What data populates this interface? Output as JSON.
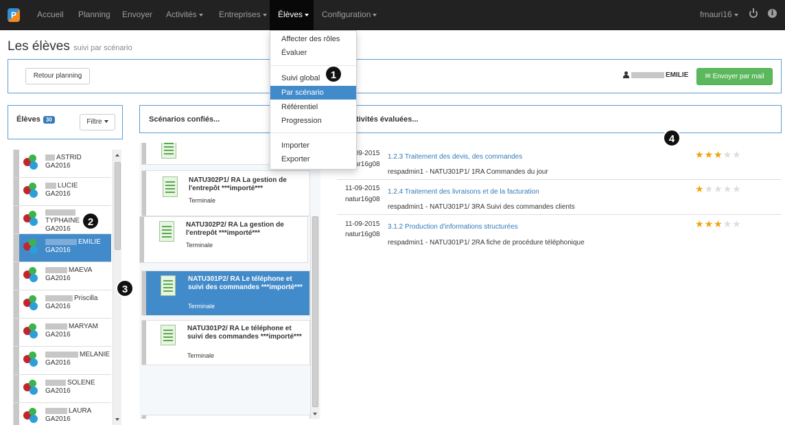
{
  "nav": {
    "items": [
      "Accueil",
      "Planning",
      "Envoyer",
      "Activités",
      "Entreprises",
      "Élèves",
      "Configuration"
    ],
    "user": "fmauri16",
    "logo": "P"
  },
  "dropdown": [
    "Affecter des rôles",
    "Évaluer",
    "Suivi global",
    "Par scénario",
    "Référentiel",
    "Progression",
    "Importer",
    "Exporter"
  ],
  "page": {
    "title": "Les élèves",
    "subtitle": "suivi par scénario"
  },
  "toolbar": {
    "back_label": "Retour planning",
    "student_first": "EMILIE",
    "mail_label": "Envoyer par mail",
    "mail_icon": "envelope-icon"
  },
  "students_panel": {
    "title": "Élèves",
    "count": "30",
    "filter_label": "Filtre"
  },
  "students": [
    {
      "name": "ASTRID",
      "group": "GA2016"
    },
    {
      "name": "LUCIE",
      "group": "GA2016"
    },
    {
      "name": "TYPHAINE",
      "group": "GA2016"
    },
    {
      "name": "EMILIE",
      "group": "GA2016"
    },
    {
      "name": "MAEVA",
      "group": "GA2016"
    },
    {
      "name": "Priscilla",
      "group": "GA2016"
    },
    {
      "name": "MARYAM",
      "group": "GA2016"
    },
    {
      "name": "MELANIE",
      "group": "GA2016"
    },
    {
      "name": "SOLENE",
      "group": "GA2016"
    },
    {
      "name": "LAURA",
      "group": "GA2016"
    }
  ],
  "scenarios_panel": {
    "title": "Scénarios confiés..."
  },
  "scenarios": [
    {
      "title": "NATU302P1/ RA La gestion de l'entrepôt ***importé***",
      "level": "Terminale"
    },
    {
      "title": "NATU302P2/ RA La gestion de l'entrepôt ***importé***",
      "level": "Terminale"
    },
    {
      "title": "NATU301P2/ RA Le téléphone et suivi des commandes ***importé***",
      "level": "Terminale"
    },
    {
      "title": "NATU301P2/ RA Le téléphone et suivi des commandes ***importé***",
      "level": "Terminale"
    }
  ],
  "activities_panel": {
    "title": "Activités évaluées..."
  },
  "activities": [
    {
      "date": "11-09-2015",
      "user": "natur16g08",
      "title": "1.2.3 Traitement des devis, des commandes",
      "desc": "respadmin1 - NATU301P1/ 1RA Commandes du jour",
      "rating": 3
    },
    {
      "date": "11-09-2015",
      "user": "natur16g08",
      "title": "1.2.4 Traitement des livraisons et de la facturation",
      "desc": "respadmin1 - NATU301P1/ 3RA Suivi des commandes clients",
      "rating": 1
    },
    {
      "date": "11-09-2015",
      "user": "natur16g08",
      "title": "3.1.2 Production d'informations structurées",
      "desc": "respadmin1 - NATU301P1/ 2RA fiche de procédure téléphonique",
      "rating": 3
    }
  ],
  "callouts": [
    "1",
    "2",
    "3",
    "4"
  ]
}
